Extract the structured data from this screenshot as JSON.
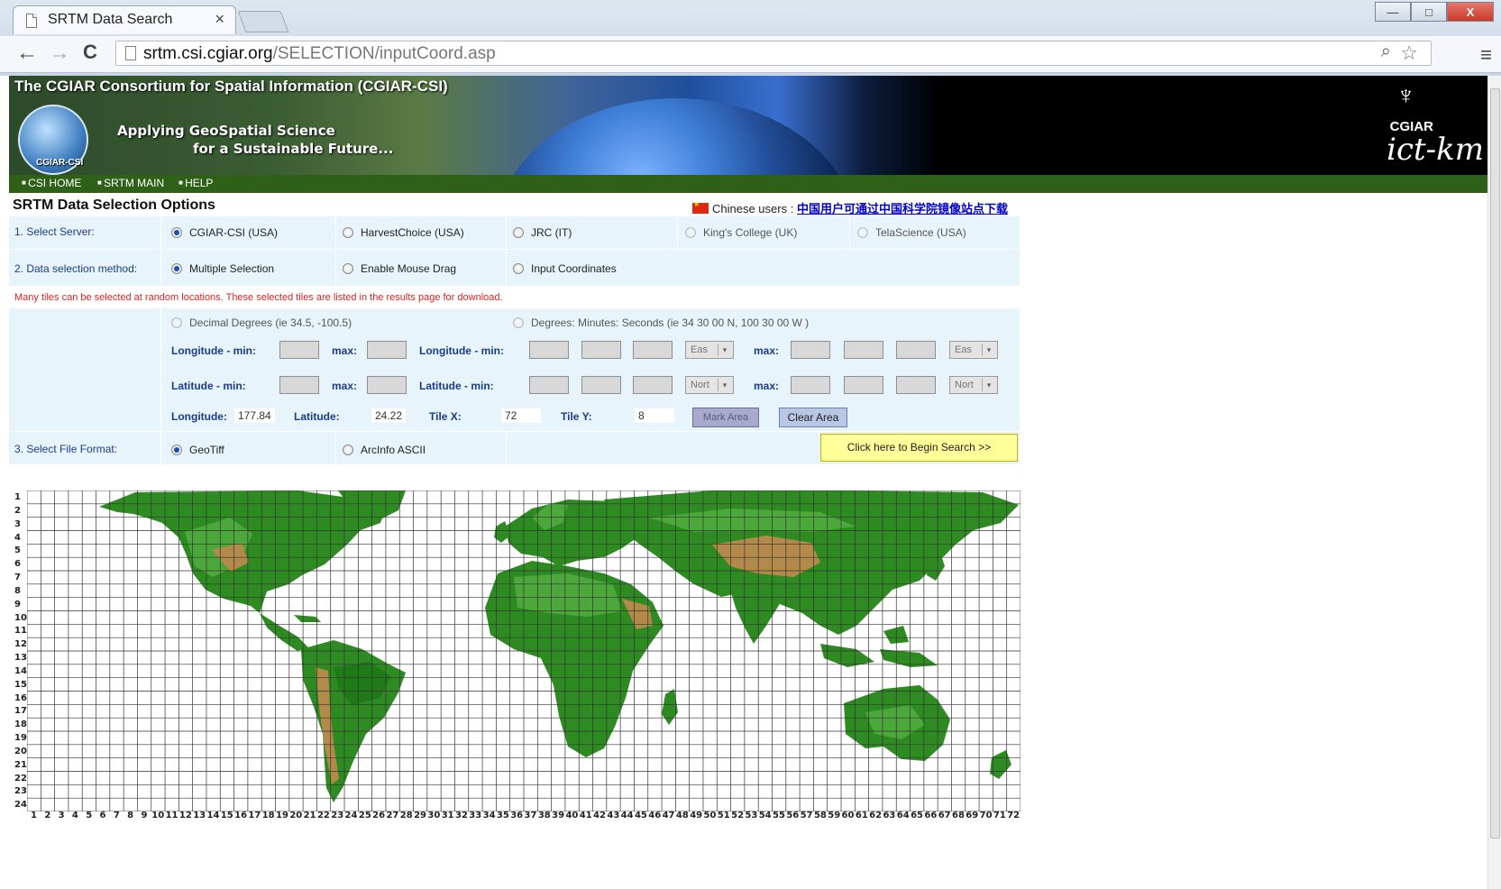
{
  "browser": {
    "tab_title": "SRTM Data Search",
    "tab_close": "×",
    "url_host": "srtm.csi.cgiar.org",
    "url_path": "/SELECTION/inputCoord.asp",
    "back": "←",
    "forward": "→",
    "reload": "C",
    "minimize": "—",
    "maximize": "□",
    "close": "X",
    "zoom_icon": "⌕",
    "star_icon": "☆",
    "menu_icon": "≡"
  },
  "banner": {
    "title": "The CGIAR Consortium for Spatial Information (CGIAR-CSI)",
    "tagline_1": "Applying GeoSpatial Science",
    "tagline_2": "for a Sustainable Future...",
    "logo_text": "CGIAR-CSI",
    "brand_mark": "♆",
    "brand_name": "CGIAR",
    "brand_sub": "ict-km"
  },
  "nav": {
    "items": [
      "CSI HOME",
      "SRTM MAIN",
      "HELP"
    ]
  },
  "page": {
    "title": "SRTM Data Selection Options",
    "chinese_label": "Chinese users :",
    "chinese_link": "中国用户可通过中国科学院镜像站点下载",
    "warning": "Many tiles can be selected at random locations. These selected tiles are listed in the results page for download.",
    "begin_search": "Click here to Begin Search >>"
  },
  "server": {
    "label": "1. Select Server:",
    "options": [
      "CGIAR-CSI (USA)",
      "HarvestChoice (USA)",
      "JRC (IT)",
      "King's College (UK)",
      "TelaScience (USA)"
    ],
    "selected": "CGIAR-CSI (USA)"
  },
  "method": {
    "label": "2. Data selection method:",
    "options": [
      "Multiple Selection",
      "Enable Mouse Drag",
      "Input Coordinates"
    ],
    "selected": "Multiple Selection"
  },
  "coords": {
    "decimal_label": "Decimal Degrees (ie 34.5, -100.5)",
    "dms_label": "Degrees: Minutes: Seconds (ie 34 30 00 N, 100 30 00 W )",
    "lon_min": "Longitude - min:",
    "lat_min": "Latitude - min:",
    "max": "max:",
    "ew": "Eas",
    "ns": "Nort",
    "select_arrow": "▾"
  },
  "readout": {
    "lon_label": "Longitude:",
    "lon_value": "177.84",
    "lat_label": "Latitude:",
    "lat_value": "24.22",
    "tilex_label": "Tile X:",
    "tilex_value": "72",
    "tiley_label": "Tile Y:",
    "tiley_value": "8",
    "mark_area": "Mark Area",
    "clear_area": "Clear Area"
  },
  "format": {
    "label": "3. Select File Format:",
    "options": [
      "GeoTiff",
      "ArcInfo ASCII"
    ],
    "selected": "GeoTiff"
  },
  "map": {
    "rows": [
      "1",
      "2",
      "3",
      "4",
      "5",
      "6",
      "7",
      "8",
      "9",
      "10",
      "11",
      "12",
      "13",
      "14",
      "15",
      "16",
      "17",
      "18",
      "19",
      "20",
      "21",
      "22",
      "23",
      "24"
    ],
    "cols": [
      "1",
      "2",
      "3",
      "4",
      "5",
      "6",
      "7",
      "8",
      "9",
      "10",
      "11",
      "12",
      "13",
      "14",
      "15",
      "16",
      "17",
      "18",
      "19",
      "20",
      "21",
      "22",
      "23",
      "24",
      "25",
      "26",
      "27",
      "28",
      "29",
      "30",
      "31",
      "32",
      "33",
      "34",
      "35",
      "36",
      "37",
      "38",
      "39",
      "40",
      "41",
      "42",
      "43",
      "44",
      "45",
      "46",
      "47",
      "48",
      "49",
      "50",
      "51",
      "52",
      "53",
      "54",
      "55",
      "56",
      "57",
      "58",
      "59",
      "60",
      "61",
      "62",
      "63",
      "64",
      "65",
      "66",
      "67",
      "68",
      "69",
      "70",
      "71",
      "72"
    ],
    "land_color": "#2e8b22",
    "highland_color": "#b38a4a",
    "grid_color": "#333333"
  }
}
